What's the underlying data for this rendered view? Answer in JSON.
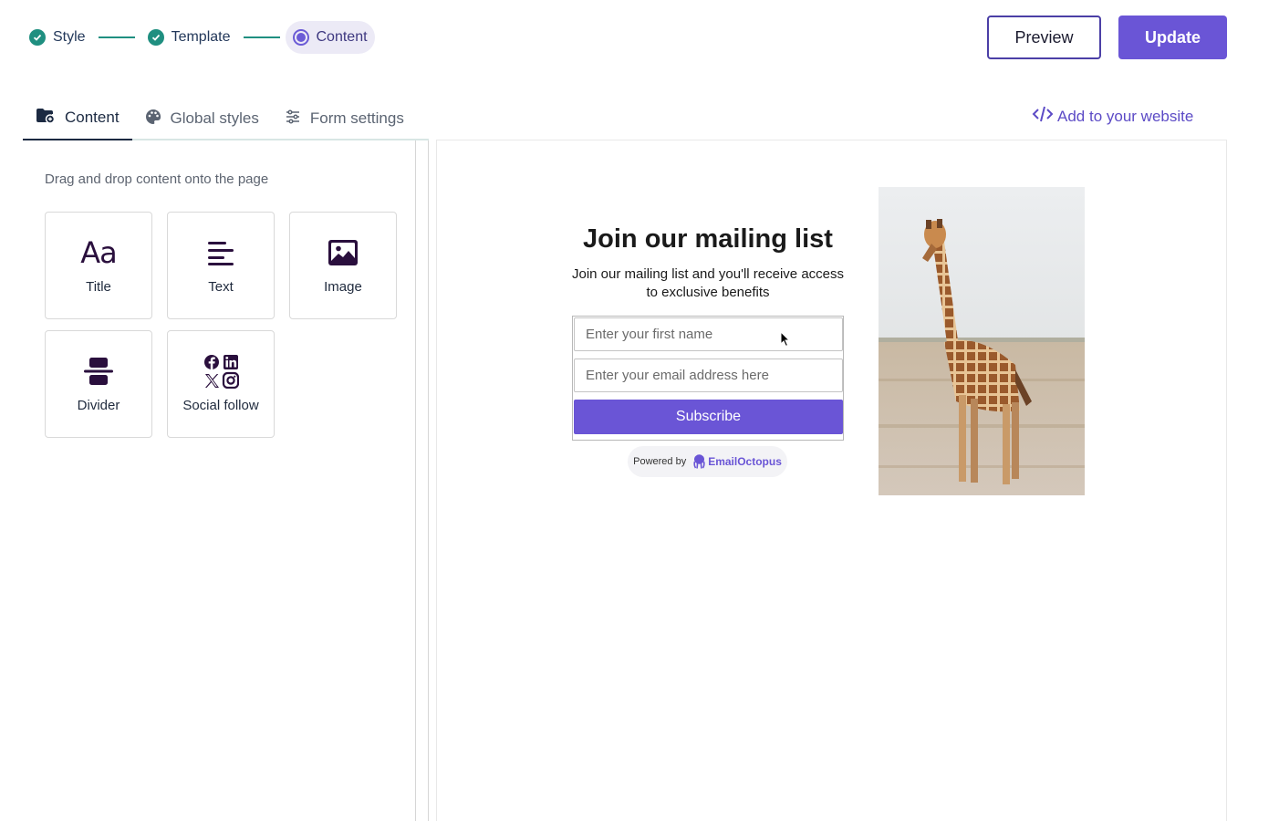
{
  "stepper": {
    "steps": [
      {
        "label": "Style",
        "state": "done"
      },
      {
        "label": "Template",
        "state": "done"
      },
      {
        "label": "Content",
        "state": "active"
      }
    ]
  },
  "header": {
    "preview_label": "Preview",
    "update_label": "Update"
  },
  "tabs": [
    {
      "label": "Content",
      "icon": "content-icon",
      "active": true
    },
    {
      "label": "Global styles",
      "icon": "palette-icon",
      "active": false
    },
    {
      "label": "Form settings",
      "icon": "sliders-icon",
      "active": false
    }
  ],
  "add_to_website": "Add to your website",
  "sidebar": {
    "hint": "Drag and drop content onto the page",
    "blocks": [
      {
        "label": "Title",
        "icon": "title-icon"
      },
      {
        "label": "Text",
        "icon": "text-icon"
      },
      {
        "label": "Image",
        "icon": "image-icon"
      },
      {
        "label": "Divider",
        "icon": "divider-icon"
      },
      {
        "label": "Social follow",
        "icon": "social-follow-icon"
      }
    ]
  },
  "form": {
    "title": "Join our mailing list",
    "subtitle": "Join our mailing list and you'll receive access to exclusive benefits",
    "first_name_placeholder": "Enter your first name",
    "email_placeholder": "Enter your email address here",
    "subscribe_label": "Subscribe",
    "powered_by": "Powered by",
    "brand": "EmailOctopus"
  },
  "colors": {
    "accent": "#6a55d6",
    "check": "#1f8f80",
    "text_dark": "#1c2a42"
  }
}
